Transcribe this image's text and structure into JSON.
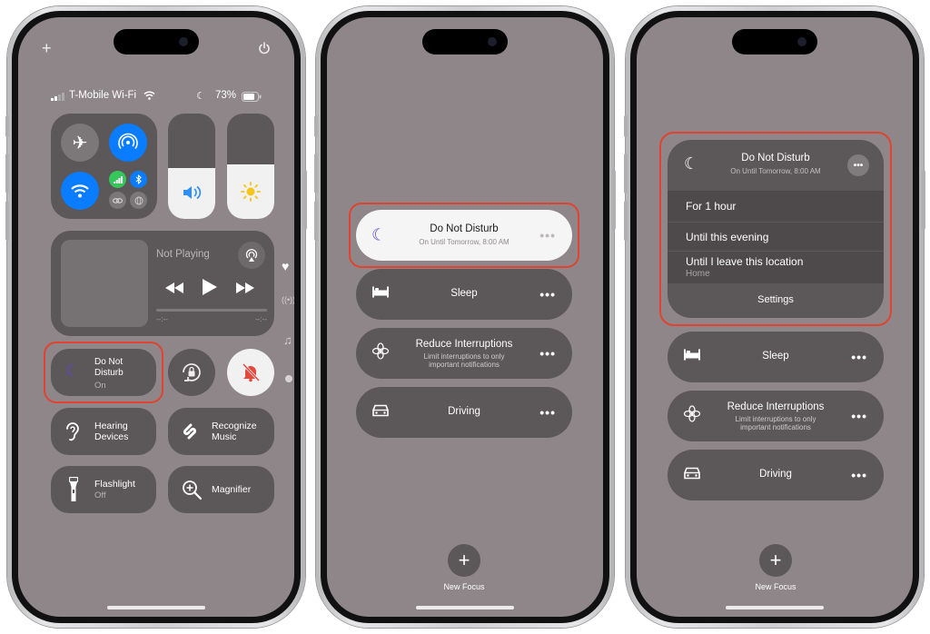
{
  "left": {
    "status": {
      "carrier": "T-Mobile Wi-Fi",
      "battery": "73%"
    },
    "top_icons": {
      "plus": "+",
      "power": "power-icon"
    },
    "now_playing": {
      "title": "Not Playing",
      "time_start": "--:--",
      "time_end": "--:--"
    },
    "dnd": {
      "label": "Do Not Disturb",
      "state": "On"
    },
    "hearing": {
      "label": "Hearing Devices"
    },
    "recognize": {
      "label": "Recognize Music"
    },
    "flashlight": {
      "label": "Flashlight",
      "state": "Off"
    },
    "magnifier": {
      "label": "Magnifier"
    },
    "volume_level": 0.48,
    "brightness_level": 0.52
  },
  "middle": {
    "dnd": {
      "title": "Do Not Disturb",
      "subtitle": "On Until Tomorrow, 8:00 AM"
    },
    "sleep": {
      "label": "Sleep"
    },
    "reduce": {
      "title": "Reduce Interruptions",
      "subtitle": "Limit interruptions to only important notifications"
    },
    "driving": {
      "label": "Driving"
    },
    "new_focus": {
      "label": "New Focus"
    }
  },
  "right": {
    "dnd": {
      "title": "Do Not Disturb",
      "subtitle": "On Until Tomorrow, 8:00 AM"
    },
    "options": [
      {
        "label": "For 1 hour",
        "sub": ""
      },
      {
        "label": "Until this evening",
        "sub": ""
      },
      {
        "label": "Until I leave this location",
        "sub": "Home"
      }
    ],
    "settings": "Settings",
    "sleep": {
      "label": "Sleep"
    },
    "reduce": {
      "title": "Reduce Interruptions",
      "subtitle": "Limit interruptions to only important notifications"
    },
    "driving": {
      "label": "Driving"
    },
    "new_focus": {
      "label": "New Focus"
    }
  },
  "more_glyph": "•••",
  "colors": {
    "accent_blue": "#0a7cff",
    "highlight": "#e0432f",
    "dnd_purple": "#5c4bd0",
    "mute_red": "#e5483c"
  }
}
